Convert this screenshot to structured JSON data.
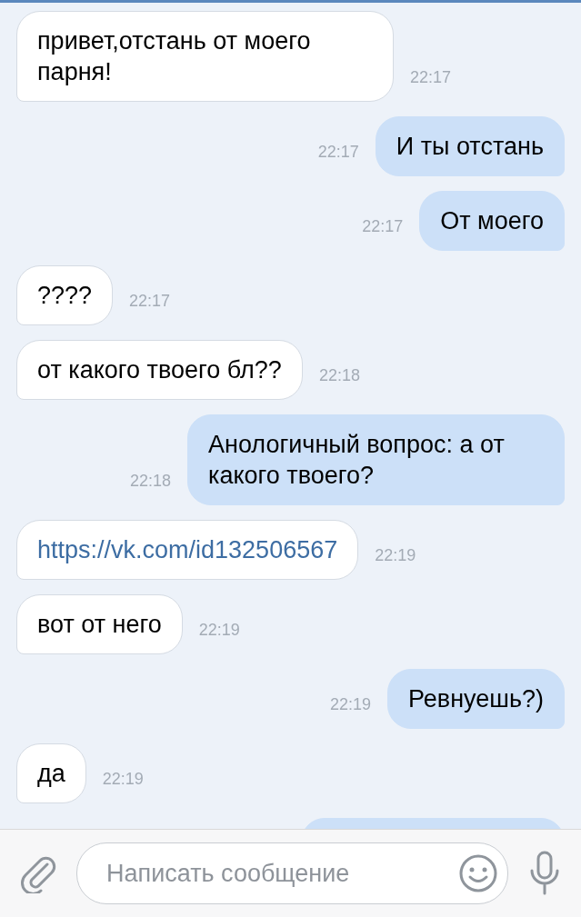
{
  "messages": [
    {
      "outgoing": false,
      "kind": "text",
      "text": "привет,отстань от моего парня!",
      "time": "22:17"
    },
    {
      "outgoing": true,
      "kind": "text",
      "text": "И ты отстань",
      "time": "22:17"
    },
    {
      "outgoing": true,
      "kind": "text",
      "text": "От моего",
      "time": "22:17"
    },
    {
      "outgoing": false,
      "kind": "text",
      "text": "????",
      "time": "22:17"
    },
    {
      "outgoing": false,
      "kind": "text",
      "text": "от какого твоего бл??",
      "time": "22:18"
    },
    {
      "outgoing": true,
      "kind": "text",
      "text": "Анологичный вопрос: а от какого твоего?",
      "time": "22:18"
    },
    {
      "outgoing": false,
      "kind": "link",
      "text": "https://vk.com/id132506567",
      "time": "22:19"
    },
    {
      "outgoing": false,
      "kind": "text",
      "text": "вот от него",
      "time": "22:19"
    },
    {
      "outgoing": true,
      "kind": "text",
      "text": "Ревнуешь?)",
      "time": "22:19"
    },
    {
      "outgoing": false,
      "kind": "text",
      "text": "да",
      "time": "22:19"
    },
    {
      "outgoing": true,
      "kind": "hidden"
    }
  ],
  "composer": {
    "placeholder": "Написать сообщение"
  }
}
